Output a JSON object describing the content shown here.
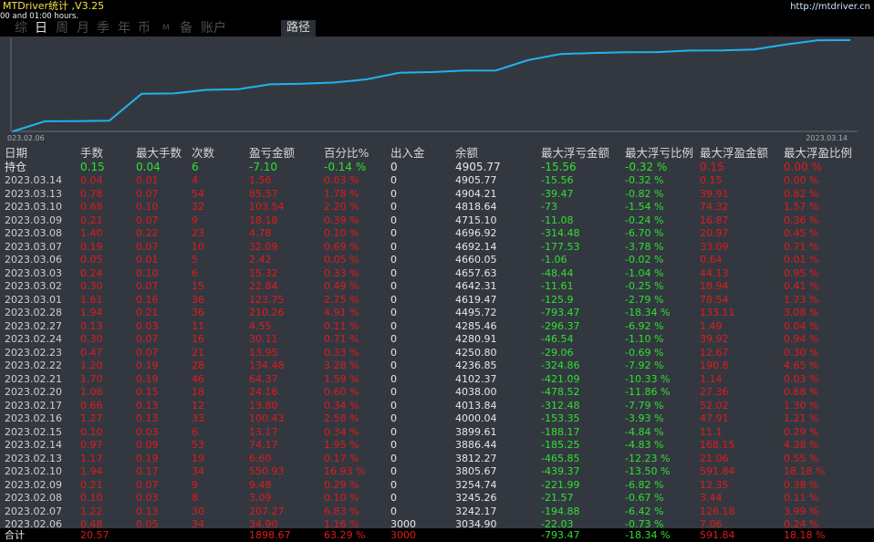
{
  "title": "MTDriver统计 ,V3.25",
  "subtitle": "00 and 01:00 hours.",
  "site": "http://mtdriver.cn",
  "tabs": [
    "综",
    "日",
    "周",
    "月",
    "季",
    "年",
    "币",
    "M",
    "备",
    "账户",
    "路径"
  ],
  "active_tab": "日",
  "chart": {
    "start_label": "023.02.06",
    "end_label": "2023.03.14",
    "line_color": "#1fb3ee",
    "balance": [
      3034.9,
      3242.17,
      3245.26,
      3254.74,
      3805.67,
      3812.27,
      3886.44,
      3899.61,
      4000.04,
      4013.84,
      4038.0,
      4102.37,
      4236.85,
      4250.8,
      4280.91,
      4285.46,
      4495.72,
      4619.47,
      4642.31,
      4657.63,
      4660.05,
      4692.14,
      4696.92,
      4715.1,
      4818.64,
      4904.21,
      4905.77
    ]
  },
  "columns": [
    "日期",
    "手数",
    "最大手数",
    "次数",
    "盈亏金额",
    "百分比%",
    "出入金",
    "余额",
    "最大浮亏金额",
    "最大浮亏比例",
    "最大浮盈金额",
    "最大浮盈比例"
  ],
  "holding": {
    "date": "持仓",
    "lots": "0.15",
    "maxlots": "0.04",
    "count": "6",
    "pnl": "-7.10",
    "pct": "-0.14 %",
    "io": "0",
    "bal": "4905.77",
    "maxloss": "-15.56",
    "maxlosspct": "-0.32 %",
    "maxprofit": "0.15",
    "maxprofitpct": "0.00 %"
  },
  "rows": [
    {
      "date": "2023.03.14",
      "lots": "0.04",
      "maxlots": "0.01",
      "count": "4",
      "pnl": "1.56",
      "pct": "0.03 %",
      "io": "0",
      "bal": "4905.77",
      "maxloss": "-15.56",
      "maxlosspct": "-0.32 %",
      "maxprofit": "0.15",
      "maxprofitpct": "0.00 %"
    },
    {
      "date": "2023.03.13",
      "lots": "0.78",
      "maxlots": "0.07",
      "count": "54",
      "pnl": "85.57",
      "pct": "1.78 %",
      "io": "0",
      "bal": "4904.21",
      "maxloss": "-39.47",
      "maxlosspct": "-0.82 %",
      "maxprofit": "39.91",
      "maxprofitpct": "0.82 %"
    },
    {
      "date": "2023.03.10",
      "lots": "0.68",
      "maxlots": "0.10",
      "count": "32",
      "pnl": "103.54",
      "pct": "2.20 %",
      "io": "0",
      "bal": "4818.64",
      "maxloss": "-73",
      "maxlosspct": "-1.54 %",
      "maxprofit": "74.32",
      "maxprofitpct": "1.57 %"
    },
    {
      "date": "2023.03.09",
      "lots": "0.21",
      "maxlots": "0.07",
      "count": "9",
      "pnl": "18.18",
      "pct": "0.39 %",
      "io": "0",
      "bal": "4715.10",
      "maxloss": "-11.08",
      "maxlosspct": "-0.24 %",
      "maxprofit": "16.87",
      "maxprofitpct": "0.36 %"
    },
    {
      "date": "2023.03.08",
      "lots": "1.40",
      "maxlots": "0.22",
      "count": "23",
      "pnl": "4.78",
      "pct": "0.10 %",
      "io": "0",
      "bal": "4696.92",
      "maxloss": "-314.48",
      "maxlosspct": "-6.70 %",
      "maxprofit": "20.97",
      "maxprofitpct": "0.45 %"
    },
    {
      "date": "2023.03.07",
      "lots": "0.19",
      "maxlots": "0.07",
      "count": "10",
      "pnl": "32.09",
      "pct": "0.69 %",
      "io": "0",
      "bal": "4692.14",
      "maxloss": "-177.53",
      "maxlosspct": "-3.78 %",
      "maxprofit": "33.09",
      "maxprofitpct": "0.71 %"
    },
    {
      "date": "2023.03.06",
      "lots": "0.05",
      "maxlots": "0.01",
      "count": "5",
      "pnl": "2.42",
      "pct": "0.05 %",
      "io": "0",
      "bal": "4660.05",
      "maxloss": "-1.06",
      "maxlosspct": "-0.02 %",
      "maxprofit": "0.64",
      "maxprofitpct": "0.01 %"
    },
    {
      "date": "2023.03.03",
      "lots": "0.24",
      "maxlots": "0.10",
      "count": "6",
      "pnl": "15.32",
      "pct": "0.33 %",
      "io": "0",
      "bal": "4657.63",
      "maxloss": "-48.44",
      "maxlosspct": "-1.04 %",
      "maxprofit": "44.13",
      "maxprofitpct": "0.95 %"
    },
    {
      "date": "2023.03.02",
      "lots": "0.30",
      "maxlots": "0.07",
      "count": "15",
      "pnl": "22.84",
      "pct": "0.49 %",
      "io": "0",
      "bal": "4642.31",
      "maxloss": "-11.61",
      "maxlosspct": "-0.25 %",
      "maxprofit": "18.94",
      "maxprofitpct": "0.41 %"
    },
    {
      "date": "2023.03.01",
      "lots": "1.61",
      "maxlots": "0.16",
      "count": "36",
      "pnl": "123.75",
      "pct": "2.75 %",
      "io": "0",
      "bal": "4619.47",
      "maxloss": "-125.9",
      "maxlosspct": "-2.79 %",
      "maxprofit": "78.54",
      "maxprofitpct": "1.73 %"
    },
    {
      "date": "2023.02.28",
      "lots": "1.94",
      "maxlots": "0.21",
      "count": "36",
      "pnl": "210.26",
      "pct": "4.91 %",
      "io": "0",
      "bal": "4495.72",
      "maxloss": "-793.47",
      "maxlosspct": "-18.34 %",
      "maxprofit": "133.11",
      "maxprofitpct": "3.08 %"
    },
    {
      "date": "2023.02.27",
      "lots": "0.13",
      "maxlots": "0.03",
      "count": "11",
      "pnl": "4.55",
      "pct": "0.11 %",
      "io": "0",
      "bal": "4285.46",
      "maxloss": "-296.37",
      "maxlosspct": "-6.92 %",
      "maxprofit": "1.49",
      "maxprofitpct": "0.04 %"
    },
    {
      "date": "2023.02.24",
      "lots": "0.30",
      "maxlots": "0.07",
      "count": "16",
      "pnl": "30.11",
      "pct": "0.71 %",
      "io": "0",
      "bal": "4280.91",
      "maxloss": "-46.54",
      "maxlosspct": "-1.10 %",
      "maxprofit": "39.92",
      "maxprofitpct": "0.94 %"
    },
    {
      "date": "2023.02.23",
      "lots": "0.47",
      "maxlots": "0.07",
      "count": "21",
      "pnl": "13.95",
      "pct": "0.33 %",
      "io": "0",
      "bal": "4250.80",
      "maxloss": "-29.06",
      "maxlosspct": "-0.69 %",
      "maxprofit": "12.67",
      "maxprofitpct": "0.30 %"
    },
    {
      "date": "2023.02.22",
      "lots": "1.20",
      "maxlots": "0.19",
      "count": "28",
      "pnl": "134.48",
      "pct": "3.28 %",
      "io": "0",
      "bal": "4236.85",
      "maxloss": "-324.86",
      "maxlosspct": "-7.92 %",
      "maxprofit": "190.8",
      "maxprofitpct": "4.65 %"
    },
    {
      "date": "2023.02.21",
      "lots": "1.70",
      "maxlots": "0.19",
      "count": "46",
      "pnl": "64.37",
      "pct": "1.59 %",
      "io": "0",
      "bal": "4102.37",
      "maxloss": "-421.09",
      "maxlosspct": "-10.33 %",
      "maxprofit": "1.14",
      "maxprofitpct": "0.03 %"
    },
    {
      "date": "2023.02.20",
      "lots": "1.06",
      "maxlots": "0.15",
      "count": "18",
      "pnl": "24.16",
      "pct": "0.60 %",
      "io": "0",
      "bal": "4038.00",
      "maxloss": "-478.52",
      "maxlosspct": "-11.86 %",
      "maxprofit": "27.36",
      "maxprofitpct": "0.68 %"
    },
    {
      "date": "2023.02.17",
      "lots": "0.66",
      "maxlots": "0.13",
      "count": "12",
      "pnl": "13.80",
      "pct": "0.34 %",
      "io": "0",
      "bal": "4013.84",
      "maxloss": "-312.48",
      "maxlosspct": "-7.79 %",
      "maxprofit": "52.02",
      "maxprofitpct": "1.30 %"
    },
    {
      "date": "2023.02.16",
      "lots": "1.27",
      "maxlots": "0.13",
      "count": "33",
      "pnl": "100.43",
      "pct": "2.58 %",
      "io": "0",
      "bal": "4000.04",
      "maxloss": "-153.35",
      "maxlosspct": "-3.93 %",
      "maxprofit": "47.91",
      "maxprofitpct": "1.21 %"
    },
    {
      "date": "2023.02.15",
      "lots": "0.10",
      "maxlots": "0.03",
      "count": "6",
      "pnl": "13.17",
      "pct": "0.34 %",
      "io": "0",
      "bal": "3899.61",
      "maxloss": "-188.17",
      "maxlosspct": "-4.84 %",
      "maxprofit": "11.1",
      "maxprofitpct": "0.29 %"
    },
    {
      "date": "2023.02.14",
      "lots": "0.97",
      "maxlots": "0.09",
      "count": "53",
      "pnl": "74.17",
      "pct": "1.95 %",
      "io": "0",
      "bal": "3886.44",
      "maxloss": "-185.25",
      "maxlosspct": "-4.83 %",
      "maxprofit": "168.15",
      "maxprofitpct": "4.38 %"
    },
    {
      "date": "2023.02.13",
      "lots": "1.17",
      "maxlots": "0.19",
      "count": "19",
      "pnl": "6.60",
      "pct": "0.17 %",
      "io": "0",
      "bal": "3812.27",
      "maxloss": "-465.85",
      "maxlosspct": "-12.23 %",
      "maxprofit": "21.06",
      "maxprofitpct": "0.55 %"
    },
    {
      "date": "2023.02.10",
      "lots": "1.94",
      "maxlots": "0.17",
      "count": "34",
      "pnl": "550.93",
      "pct": "16.93 %",
      "io": "0",
      "bal": "3805.67",
      "maxloss": "-439.37",
      "maxlosspct": "-13.50 %",
      "maxprofit": "591.84",
      "maxprofitpct": "18.18 %"
    },
    {
      "date": "2023.02.09",
      "lots": "0.21",
      "maxlots": "0.07",
      "count": "9",
      "pnl": "9.48",
      "pct": "0.29 %",
      "io": "0",
      "bal": "3254.74",
      "maxloss": "-221.99",
      "maxlosspct": "-6.82 %",
      "maxprofit": "12.35",
      "maxprofitpct": "0.38 %"
    },
    {
      "date": "2023.02.08",
      "lots": "0.10",
      "maxlots": "0.03",
      "count": "8",
      "pnl": "3.09",
      "pct": "0.10 %",
      "io": "0",
      "bal": "3245.26",
      "maxloss": "-21.57",
      "maxlosspct": "-0.67 %",
      "maxprofit": "3.44",
      "maxprofitpct": "0.11 %"
    },
    {
      "date": "2023.02.07",
      "lots": "1.22",
      "maxlots": "0.13",
      "count": "30",
      "pnl": "207.27",
      "pct": "6.83 %",
      "io": "0",
      "bal": "3242.17",
      "maxloss": "-194.88",
      "maxlosspct": "-6.42 %",
      "maxprofit": "126.18",
      "maxprofitpct": "3.99 %"
    },
    {
      "date": "2023.02.06",
      "lots": "0.48",
      "maxlots": "0.05",
      "count": "34",
      "pnl": "34.90",
      "pct": "1.16 %",
      "io": "3000",
      "bal": "3034.90",
      "maxloss": "-22.03",
      "maxlosspct": "-0.73 %",
      "maxprofit": "7.06",
      "maxprofitpct": "0.24 %"
    }
  ],
  "total": {
    "date": "合计",
    "lots": "20.57",
    "maxlots": "",
    "count": "",
    "pnl": "1898.67",
    "pct": "63.29 %",
    "io": "3000",
    "bal": "",
    "maxloss": "-793.47",
    "maxlosspct": "-18.34 %",
    "maxprofit": "591.84",
    "maxprofitpct": "18.18 %"
  },
  "colors": {
    "loss": "#2fe02f",
    "profit": "#e21a1a",
    "line": "#1fb3ee"
  }
}
